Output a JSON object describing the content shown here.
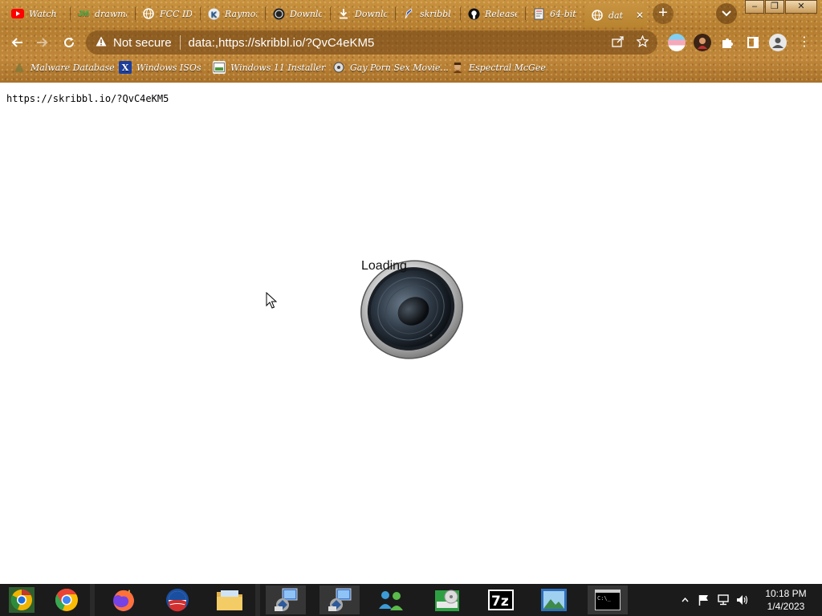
{
  "tabs": [
    {
      "label": "Watch",
      "icon": "youtube-icon",
      "color": "#ff0000"
    },
    {
      "label": "drawma",
      "icon": "jm-icon",
      "color": "#3aa04a"
    },
    {
      "label": "FCC ID",
      "icon": "globe-icon",
      "color": "#ffffff"
    },
    {
      "label": "Raymon",
      "icon": "k-logo-icon",
      "color": "#2a5a8a"
    },
    {
      "label": "Downlo",
      "icon": "obs-icon",
      "color": "#222222"
    },
    {
      "label": "Downlo",
      "icon": "download-icon",
      "color": "#ffffff"
    },
    {
      "label": "skribbl",
      "icon": "pencil-icon",
      "color": "#2b4fb8"
    },
    {
      "label": "Release",
      "icon": "github-icon",
      "color": "#111111"
    },
    {
      "label": "64-bit",
      "icon": "document-icon",
      "color": "#ffffff"
    },
    {
      "label": "dat",
      "icon": "globe-icon",
      "color": "#ffffff",
      "active": true
    }
  ],
  "tab_close": "✕",
  "new_tab": "+",
  "omnibox": {
    "security_label": "Not secure",
    "url": "data:,https://skribbl.io/?QvC4eKM5"
  },
  "bookmarks": [
    {
      "label": "Malware Database",
      "icon": "malware-icon"
    },
    {
      "label": "Windows ISOs",
      "icon": "x-icon"
    },
    {
      "label": "Windows 11 Installer",
      "icon": "installer-icon"
    },
    {
      "label": "Gay Porn Sex Movie...",
      "icon": "film-icon"
    },
    {
      "label": "Espectral McGee",
      "icon": "avatar-icon"
    }
  ],
  "page": {
    "text": "https://skribbl.io/?QvC4eKM5",
    "loading": "Loading"
  },
  "taskbar": {
    "time": "10:18 PM",
    "date": "1/4/2023",
    "apps": [
      "chrome-canary",
      "chrome",
      "firefox",
      "obama",
      "file-explorer",
      "remote-desktop-1",
      "remote-desktop-2",
      "network-users",
      "disk-image",
      "7zip",
      "photo-viewer",
      "command-prompt"
    ]
  },
  "colors": {
    "chrome_brown": "#b57d2f",
    "taskbar": "#1b1b1b"
  }
}
